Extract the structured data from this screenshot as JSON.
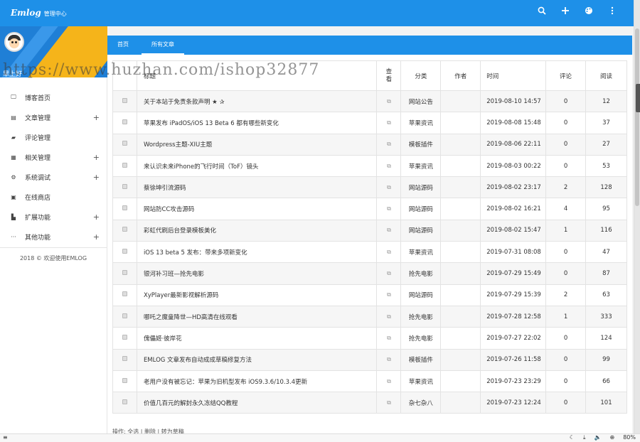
{
  "header": {
    "logo": "Emlog",
    "subtitle": "管理中心"
  },
  "header_icons": [
    "search-icon",
    "plus-icon",
    "palette-icon",
    "more-vert-icon"
  ],
  "sidebar": {
    "greeting": "早上好",
    "items": [
      {
        "label": "博客首页",
        "icon": "monitor-icon",
        "expandable": false
      },
      {
        "label": "文章管理",
        "icon": "clipboard-icon",
        "expandable": true
      },
      {
        "label": "评论管理",
        "icon": "comment-icon",
        "expandable": false
      },
      {
        "label": "相关管理",
        "icon": "grid-icon",
        "expandable": true
      },
      {
        "label": "系统调试",
        "icon": "gear-icon",
        "expandable": true
      },
      {
        "label": "在线商店",
        "icon": "store-icon",
        "expandable": false
      },
      {
        "label": "扩展功能",
        "icon": "plugin-icon",
        "expandable": true
      },
      {
        "label": "其他功能",
        "icon": "dots-icon",
        "expandable": true
      }
    ],
    "footer": "2018 © 欢迎使用EMLOG"
  },
  "tabs": {
    "home": "首页",
    "all_posts": "所有文章"
  },
  "table": {
    "headers": {
      "title": "标题",
      "view": "查看",
      "category": "分类",
      "author": "作者",
      "time": "时间",
      "comments": "评论",
      "reads": "阅读"
    },
    "rows": [
      {
        "title": "关于本站于免责条款声明 ★ ✰",
        "category": "网站公告",
        "author": "",
        "time": "2019-08-10 14:57",
        "comments": "0",
        "reads": "12"
      },
      {
        "title": "苹果发布 iPadOS/iOS 13 Beta 6 都有哪些新变化",
        "category": "苹果资讯",
        "author": "",
        "time": "2019-08-08 15:48",
        "comments": "0",
        "reads": "37"
      },
      {
        "title": "Wordpress主题-XIU主题",
        "category": "模板插件",
        "author": "",
        "time": "2019-08-06 22:11",
        "comments": "0",
        "reads": "27"
      },
      {
        "title": "来认识未来iPhone的飞行时间（ToF）镜头",
        "category": "苹果资讯",
        "author": "",
        "time": "2019-08-03 00:22",
        "comments": "0",
        "reads": "53"
      },
      {
        "title": "蔡徐坤引流源码",
        "category": "网站源码",
        "author": "",
        "time": "2019-08-02 23:17",
        "comments": "2",
        "reads": "128"
      },
      {
        "title": "网站防CC攻击源码",
        "category": "网站源码",
        "author": "",
        "time": "2019-08-02 16:21",
        "comments": "4",
        "reads": "95"
      },
      {
        "title": "彩虹代刷后台登录模板美化",
        "category": "网站源码",
        "author": "",
        "time": "2019-08-02 15:47",
        "comments": "1",
        "reads": "116"
      },
      {
        "title": "iOS 13 beta 5 发布：带来多项新变化",
        "category": "苹果资讯",
        "author": "",
        "time": "2019-07-31 08:08",
        "comments": "0",
        "reads": "47"
      },
      {
        "title": "银河补习班—抢先电影",
        "category": "抢先电影",
        "author": "",
        "time": "2019-07-29 15:49",
        "comments": "0",
        "reads": "87"
      },
      {
        "title": "XyPlayer最新影视解析源码",
        "category": "网站源码",
        "author": "",
        "time": "2019-07-29 15:39",
        "comments": "2",
        "reads": "63"
      },
      {
        "title": "哪吒之魔童降世—HD高清在线观看",
        "category": "抢先电影",
        "author": "",
        "time": "2019-07-28 12:58",
        "comments": "1",
        "reads": "333"
      },
      {
        "title": "傀儡姬·彼岸花",
        "category": "抢先电影",
        "author": "",
        "time": "2019-07-27 22:02",
        "comments": "0",
        "reads": "124"
      },
      {
        "title": "EMLOG 文章发布自动成成草稿修复方法",
        "category": "模板插件",
        "author": "",
        "time": "2019-07-26 11:58",
        "comments": "0",
        "reads": "99"
      },
      {
        "title": "老用户没有被忘记：苹果为旧机型发布 iOS9.3.6/10.3.4更新",
        "category": "苹果资讯",
        "author": "",
        "time": "2019-07-23 23:29",
        "comments": "0",
        "reads": "66"
      },
      {
        "title": "价值几百元的解封永久冻结QQ教程",
        "category": "杂七杂八",
        "author": "",
        "time": "2019-07-23 12:24",
        "comments": "0",
        "reads": "101"
      }
    ]
  },
  "bottom_ops": "操作: 全选 | 删除 | 转为草稿",
  "watermark": "https://www.huzhan.com/ishop32877",
  "statusbar": {
    "zoom": "80%"
  }
}
